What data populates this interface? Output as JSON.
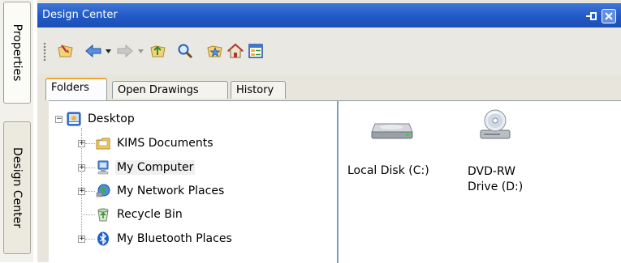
{
  "side_tabs": [
    "Properties",
    "Design Center"
  ],
  "window": {
    "title": "Design Center"
  },
  "toolbar": {
    "icons": [
      "load-icon",
      "back-icon",
      "back-dropdown-icon",
      "forward-icon",
      "forward-dropdown-icon",
      "up-folder-icon",
      "search-icon",
      "favorites-icon",
      "home-icon",
      "tree-view-toggle-icon"
    ]
  },
  "tabs": [
    {
      "label": "Folders",
      "active": true
    },
    {
      "label": "Open Drawings",
      "active": false
    },
    {
      "label": "History",
      "active": false
    }
  ],
  "tree": {
    "root": {
      "label": "Desktop",
      "expander": "−"
    },
    "children": [
      {
        "label": "KIMS Documents",
        "expander": "+",
        "icon": "documents-icon"
      },
      {
        "label": "My Computer",
        "expander": "+",
        "icon": "computer-icon",
        "selected": true
      },
      {
        "label": "My Network Places",
        "expander": "+",
        "icon": "network-icon"
      },
      {
        "label": "Recycle Bin",
        "expander": "",
        "icon": "recycle-bin-icon"
      },
      {
        "label": "My Bluetooth Places",
        "expander": "+",
        "icon": "bluetooth-icon"
      }
    ]
  },
  "drives": [
    {
      "label": "Local Disk (C:)",
      "icon": "hard-disk-icon"
    },
    {
      "label": "DVD-RW Drive (D:)",
      "icon": "dvd-drive-icon"
    }
  ],
  "colors": {
    "titlebar": "#2059c7",
    "active_tab_accent": "#f1a531",
    "pane_border": "#7f9db9"
  }
}
